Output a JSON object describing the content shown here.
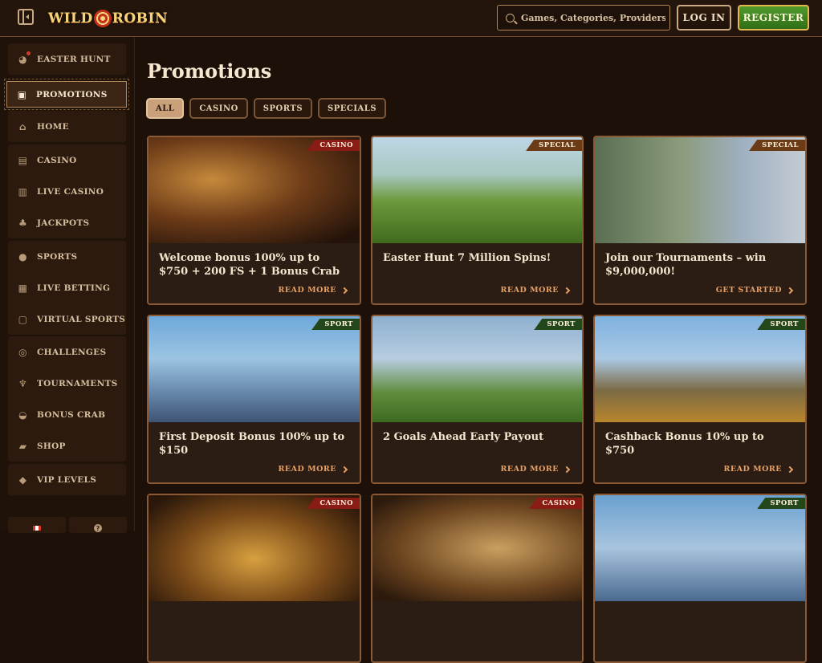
{
  "header": {
    "logo_text_left": "WILD",
    "logo_text_right": "ROBIN",
    "search_placeholder": "Games, Categories, Providers",
    "login_label": "LOG IN",
    "register_label": "REGISTER"
  },
  "sidebar": {
    "groups": [
      [
        {
          "label": "EASTER HUNT",
          "icon": "egg-icon"
        }
      ],
      [
        {
          "label": "PROMOTIONS",
          "icon": "gift-icon",
          "active": true
        }
      ],
      [
        {
          "label": "HOME",
          "icon": "home-icon"
        }
      ],
      [
        {
          "label": "CASINO",
          "icon": "casino-icon"
        },
        {
          "label": "LIVE CASINO",
          "icon": "cards-icon"
        },
        {
          "label": "JACKPOTS",
          "icon": "clover-icon"
        }
      ],
      [
        {
          "label": "SPORTS",
          "icon": "ball-icon"
        },
        {
          "label": "LIVE BETTING",
          "icon": "live-icon"
        },
        {
          "label": "VIRTUAL SPORTS",
          "icon": "virtual-icon"
        }
      ],
      [
        {
          "label": "CHALLENGES",
          "icon": "target-icon"
        },
        {
          "label": "TOURNAMENTS",
          "icon": "trophy-icon"
        },
        {
          "label": "BONUS CRAB",
          "icon": "crab-icon"
        },
        {
          "label": "SHOP",
          "icon": "bag-icon"
        }
      ],
      [
        {
          "label": "VIP LEVELS",
          "icon": "diamond-icon"
        }
      ]
    ],
    "help_symbol": "?"
  },
  "main": {
    "title": "Promotions",
    "filters": [
      "ALL",
      "CASINO",
      "SPORTS",
      "SPECIALS"
    ],
    "active_filter": "ALL",
    "cards": [
      {
        "badge": "CASINO",
        "badge_type": "casino",
        "title": "Welcome bonus 100% up to $750 + 200 FS + 1 Bonus Crab",
        "link": "READ MORE",
        "art": "art-1"
      },
      {
        "badge": "SPECIAL",
        "badge_type": "special",
        "title": "Easter Hunt 7 Million Spins!",
        "link": "READ MORE",
        "art": "art-2"
      },
      {
        "badge": "SPECIAL",
        "badge_type": "special",
        "title": "Join our Tournaments – win $9,000,000!",
        "link": "GET STARTED",
        "art": "art-3"
      },
      {
        "badge": "SPORT",
        "badge_type": "sport",
        "title": "First Deposit Bonus 100% up to $150",
        "link": "READ MORE",
        "art": "art-4"
      },
      {
        "badge": "SPORT",
        "badge_type": "sport",
        "title": "2 Goals Ahead Early Payout",
        "link": "READ MORE",
        "art": "art-5"
      },
      {
        "badge": "SPORT",
        "badge_type": "sport",
        "title": "Cashback Bonus 10% up to $750",
        "link": "READ MORE",
        "art": "art-6"
      },
      {
        "badge": "CASINO",
        "badge_type": "casino",
        "title": "",
        "link": "",
        "art": "art-7"
      },
      {
        "badge": "CASINO",
        "badge_type": "casino",
        "title": "",
        "link": "",
        "art": "art-8"
      },
      {
        "badge": "SPORT",
        "badge_type": "sport",
        "title": "",
        "link": "",
        "art": "art-9"
      }
    ]
  },
  "colors": {
    "background": "#1c1009",
    "accent_link": "#e6a066",
    "register_green": "#3f8422",
    "badge_casino": "#8a1c16",
    "badge_special": "#6b3b16",
    "badge_sport": "#23461a"
  }
}
